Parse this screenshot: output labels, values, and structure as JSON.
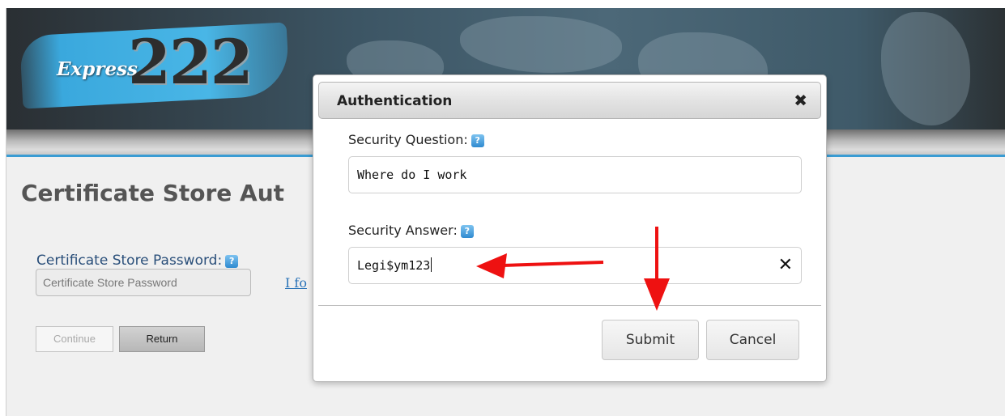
{
  "brand": {
    "word": "Express",
    "number": "222"
  },
  "page": {
    "title": "Certificate Store Aut",
    "password_label": "Certificate Store Password:",
    "password_placeholder": "Certificate Store Password",
    "forgot_link": "I fo",
    "continue_label": "Continue",
    "return_label": "Return"
  },
  "dialog": {
    "title": "Authentication",
    "close_glyph": "✖",
    "question_label": "Security Question:",
    "question_value": "Where do I work",
    "answer_label": "Security Answer:",
    "answer_value": "Legi$ym123",
    "clear_glyph": "✕",
    "submit_label": "Submit",
    "cancel_label": "Cancel"
  },
  "icons": {
    "help": "?"
  },
  "colors": {
    "accent": "#3a9cd3",
    "arrow": "#ee1111",
    "label_blue": "#2a4f7a"
  }
}
